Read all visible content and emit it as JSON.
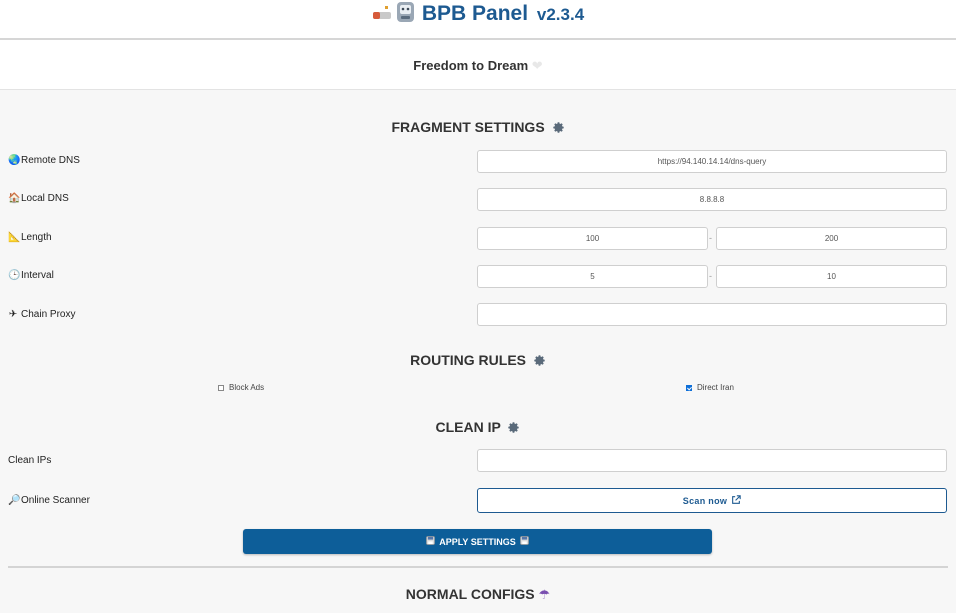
{
  "header": {
    "title": "BPB Panel",
    "version": "v2.3.4",
    "logo_icon": "vpn-robot-icon",
    "accent_color": "#1d5a91"
  },
  "slogan": {
    "text": "Freedom to Dream",
    "heart_icon": "white-heart-icon"
  },
  "fragment": {
    "title": "FRAGMENT SETTINGS",
    "remote_dns_label": "Remote DNS",
    "remote_dns_value": "https://94.140.14.14/dns-query",
    "local_dns_label": "Local DNS",
    "local_dns_value": "8.8.8.8",
    "length_label": "Length",
    "length_min": "100",
    "length_max": "200",
    "interval_label": "Interval",
    "interval_min": "5",
    "interval_max": "10",
    "range_separator": "-",
    "chain_proxy_label": "Chain Proxy",
    "chain_proxy_value": ""
  },
  "routing": {
    "title": "ROUTING RULES",
    "block_ads_label": "Block Ads",
    "block_ads_checked": false,
    "direct_iran_label": "Direct Iran",
    "direct_iran_checked": true
  },
  "clean_ip": {
    "title": "CLEAN IP",
    "clean_ips_label": "Clean IPs",
    "clean_ips_value": "",
    "scanner_label": "Online Scanner",
    "scan_button_label": "Scan now"
  },
  "apply_button_label": "APPLY SETTINGS",
  "normal_configs_title": "NORMAL CONFIGS"
}
